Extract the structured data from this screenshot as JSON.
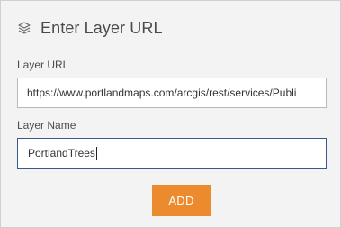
{
  "dialog": {
    "title": "Enter Layer URL",
    "title_icon": "layers-icon"
  },
  "form": {
    "url": {
      "label": "Layer URL",
      "value": "https://www.portlandmaps.com/arcgis/rest/services/Publi"
    },
    "name": {
      "label": "Layer Name",
      "value": "PortlandTrees"
    },
    "add_label": "ADD"
  },
  "colors": {
    "accent_button": "#ec8b2d",
    "focused_border": "#37598c",
    "background": "#f3f3f3"
  }
}
